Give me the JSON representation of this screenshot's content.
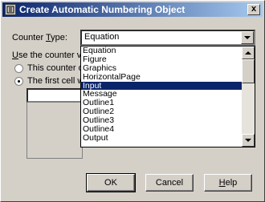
{
  "window": {
    "title": "Create Automatic Numbering Object",
    "close_glyph": "x"
  },
  "counter_type": {
    "label": "Counter Type:",
    "selected": "Equation",
    "options": [
      "Equation",
      "Figure",
      "Graphics",
      "HorizontalPage",
      "Input",
      "Message",
      "Outline1",
      "Outline2",
      "Outline3",
      "Outline4",
      "Output"
    ],
    "highlighted": "Input"
  },
  "use_counter_label": "Use the counter val",
  "radio_options": [
    {
      "label": "This counter ob",
      "checked": false
    },
    {
      "label": "The first cell wit",
      "checked": true
    }
  ],
  "buttons": {
    "ok": "OK",
    "cancel": "Cancel",
    "help": "Help"
  }
}
